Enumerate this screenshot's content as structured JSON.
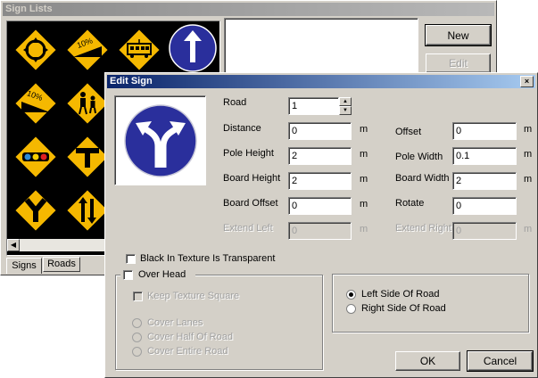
{
  "sign_lists": {
    "title": "Sign Lists",
    "new_label": "New",
    "edit_label": "Edit",
    "tabs": [
      {
        "label": "Signs"
      },
      {
        "label": "Roads"
      }
    ],
    "sign_icons": [
      "roundabout-icon",
      "slope-10-percent-icon",
      "tram-crossing-icon",
      "straight-ahead-icon",
      "steep-descent-10-percent-icon",
      "pedestrians-icon",
      "traffic-signal-icon",
      "t-junction-icon",
      "y-junction-icon",
      "two-way-traffic-icon"
    ]
  },
  "edit_sign": {
    "title": "Edit Sign",
    "road_label": "Road",
    "road_value": "1",
    "fields_left": [
      {
        "label": "Distance",
        "value": "0",
        "unit": "m"
      },
      {
        "label": "Pole Height",
        "value": "2",
        "unit": "m"
      },
      {
        "label": "Board Height",
        "value": "2",
        "unit": "m"
      },
      {
        "label": "Board Offset",
        "value": "0",
        "unit": "m"
      },
      {
        "label": "Extend Left",
        "value": "0",
        "unit": "m"
      }
    ],
    "fields_right": [
      {
        "label": "Offset",
        "value": "0",
        "unit": "m"
      },
      {
        "label": "Pole Width",
        "value": "0.1",
        "unit": "m"
      },
      {
        "label": "Board Width",
        "value": "2",
        "unit": "m"
      },
      {
        "label": "Rotate",
        "value": "0",
        "unit": ""
      },
      {
        "label": "Extend Right",
        "value": "0",
        "unit": "m"
      }
    ],
    "black_transparent_label": "Black In Texture Is Transparent",
    "over_head_label": "Over Head",
    "keep_square_label": "Keep Texture Square",
    "cover_options": [
      "Cover Lanes",
      "Cover Half Of Road",
      "Cover Entire Road"
    ],
    "side_options": [
      "Left Side Of Road",
      "Right Side Of Road"
    ],
    "selected_side": "Left Side Of Road",
    "ok_label": "OK",
    "cancel_label": "Cancel",
    "close_glyph": "×",
    "preview_icon": "fork-left-right-icon",
    "colors": {
      "sign_blue": "#2a2f9c",
      "sign_yellow": "#f5b800",
      "title_active": "#0a246a"
    }
  }
}
